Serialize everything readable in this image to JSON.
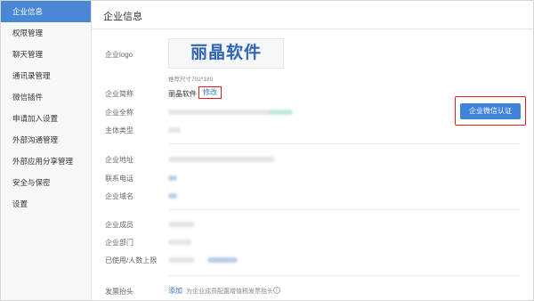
{
  "sidebar": {
    "items": [
      {
        "label": "企业信息",
        "active": true
      },
      {
        "label": "权限管理"
      },
      {
        "label": "聊天管理"
      },
      {
        "label": "通讯录管理"
      },
      {
        "label": "微信插件"
      },
      {
        "label": "申请加入设置"
      },
      {
        "label": "外部沟通管理"
      },
      {
        "label": "外部应用分享管理"
      },
      {
        "label": "安全与保密"
      },
      {
        "label": "设置"
      }
    ]
  },
  "main": {
    "title": "企业信息",
    "logo": {
      "label": "企业logo",
      "text": "丽晶软件",
      "hint": "推荐尺寸702*180"
    },
    "short_name": {
      "label": "企业简称",
      "value": "丽晶软件",
      "edit": "修改"
    },
    "full_name": {
      "label": "企业全称"
    },
    "subject_type": {
      "label": "主体类型"
    },
    "address": {
      "label": "企业地址"
    },
    "phone": {
      "label": "联系电话"
    },
    "domain": {
      "label": "企业域名"
    },
    "members": {
      "label": "企业成员"
    },
    "departments": {
      "label": "企业部门"
    },
    "usage": {
      "label": "已使用/人数上限"
    },
    "invoice": {
      "label": "发票抬头",
      "add": "添加",
      "desc": "为企业成员配置增值税发票抬头",
      "info_icon": "i"
    },
    "auth_button": "企业微信认证"
  },
  "colors": {
    "accent": "#4a88d6",
    "button": "#3f82d8",
    "link": "#3a76c4",
    "highlight": "#e02020",
    "logo": "#2f65b5"
  }
}
